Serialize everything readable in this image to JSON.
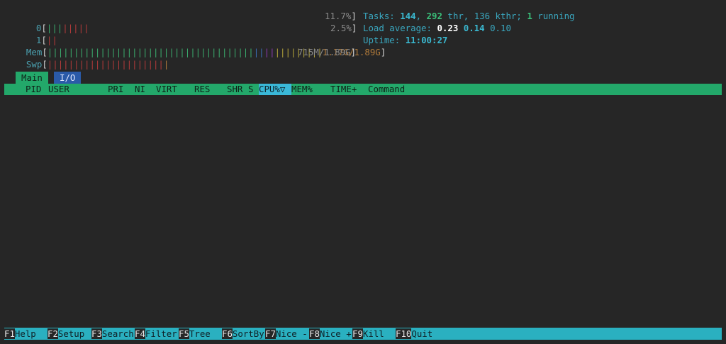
{
  "meters": {
    "cpu0": {
      "label": "0",
      "value": "11.7%"
    },
    "cpu1": {
      "label": "1",
      "value": "2.5%"
    },
    "mem": {
      "label": "Mem",
      "value": "1.17G/1.89G"
    },
    "swp": {
      "label": "Swp",
      "value": "715M/1.89G"
    }
  },
  "summary": {
    "tasks_label": "Tasks:",
    "tasks_count": "144",
    "threads_count": "292",
    "threads_label": "thr,",
    "kthreads": "136 kthr;",
    "running_count": "1",
    "running_label": "running",
    "load_label": "Load average:",
    "load1": "0.23",
    "load5": "0.14",
    "load15": "0.10",
    "uptime_label": "Uptime:",
    "uptime_value": "11:00:27"
  },
  "tabs": [
    {
      "label": "Main"
    },
    {
      "label": "I/O"
    }
  ],
  "columns": [
    "PID",
    "USER",
    "PRI",
    "NI",
    "VIRT",
    "RES",
    "SHR",
    "S",
    "CPU%",
    "▽",
    "MEM%",
    "TIME+",
    "Command"
  ],
  "function_keys": [
    {
      "key": "F1",
      "label": "Help"
    },
    {
      "key": "F2",
      "label": "Setup"
    },
    {
      "key": "F3",
      "label": "Search"
    },
    {
      "key": "F4",
      "label": "Filter"
    },
    {
      "key": "F5",
      "label": "Tree"
    },
    {
      "key": "F6",
      "label": "SortBy"
    },
    {
      "key": "F7",
      "label": "Nice -"
    },
    {
      "key": "F8",
      "label": "Nice +"
    },
    {
      "key": "F9",
      "label": "Kill"
    },
    {
      "key": "F10",
      "label": "Quit"
    }
  ],
  "colors": {
    "background": "#262626",
    "tab_active": "#23a86a",
    "tab_io": "#2a5aa8",
    "header_bar": "#23a86a",
    "sort_column": "#3ab8d8",
    "function_bar": "#2ab0c0"
  }
}
